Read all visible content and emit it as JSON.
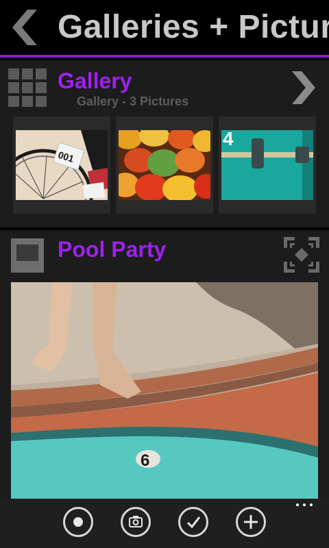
{
  "header": {
    "title": "Galleries + Pictures"
  },
  "gallery_section": {
    "title": "Gallery",
    "subtitle": "Gallery - 3 Pictures",
    "thumbnails": [
      {
        "subject": "bicycle wheel with race number",
        "label": "001"
      },
      {
        "subject": "pile of mangoes"
      },
      {
        "subject": "teal door with latch",
        "label": "4"
      }
    ]
  },
  "picture_section": {
    "title": "Pool Party",
    "photo": {
      "subject": "feet stepping on pool edge",
      "number": "6"
    }
  },
  "app_bar": {
    "buttons": [
      "record-icon",
      "camera-icon",
      "check-icon",
      "add-icon"
    ],
    "more": "more-icon"
  },
  "colors": {
    "accent": "#a020f0",
    "accent_line": "#8a1ee0",
    "title_gray": "#c8c8c8",
    "panel": "#1c1c1c"
  }
}
